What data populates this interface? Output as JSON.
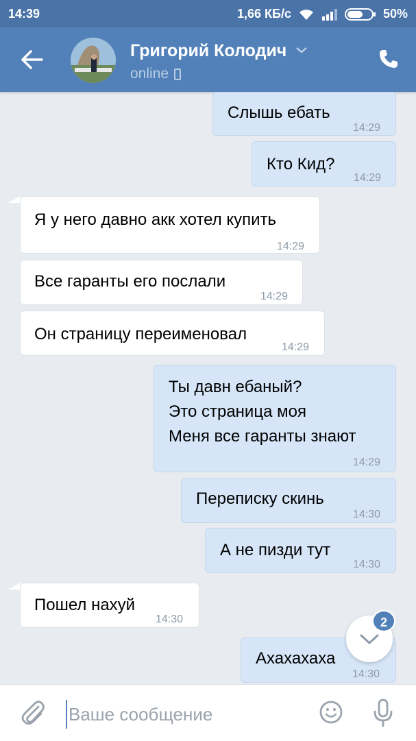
{
  "status_bar": {
    "time": "14:39",
    "network_speed": "1,66 КБ/с",
    "battery": "50%",
    "icons": [
      "wifi-icon",
      "signal-icon",
      "battery-icon"
    ]
  },
  "header": {
    "contact_name": "Григорий Колодич",
    "status": "online",
    "icons": [
      "back-arrow-icon",
      "chevron-down-icon",
      "mobile-device-icon",
      "phone-call-icon"
    ]
  },
  "messages": [
    {
      "direction": "out",
      "text": "Слышь ебать",
      "time": "14:29"
    },
    {
      "direction": "out",
      "text": "Кто Кид?",
      "time": "14:29"
    },
    {
      "direction": "in",
      "text": "Я у него давно акк хотел купить",
      "time": "14:29"
    },
    {
      "direction": "in",
      "text": "Все гаранты его послали",
      "time": "14:29"
    },
    {
      "direction": "in",
      "text": "Он страницу переименовал",
      "time": "14:29"
    },
    {
      "direction": "out",
      "text": "Ты давн ебаный?\nЭто страница моя\nМеня все гаранты знают",
      "time": "14:29"
    },
    {
      "direction": "out",
      "text": "Переписку скинь",
      "time": "14:30"
    },
    {
      "direction": "out",
      "text": "А не пизди тут",
      "time": "14:30"
    },
    {
      "direction": "in",
      "text": "Пошел нахуй",
      "time": "14:30"
    },
    {
      "direction": "out",
      "text": "Ахахахаха",
      "time": "14:30"
    }
  ],
  "scroll_down": {
    "unread_count": "2"
  },
  "composer": {
    "placeholder": "Ваше сообщение",
    "value": ""
  },
  "colors": {
    "header": "#5181b8",
    "status_bar": "#4a73a8",
    "chat_background": "#e8ecf0",
    "outgoing_bubble": "#d6e6f8",
    "incoming_bubble": "#ffffff"
  }
}
